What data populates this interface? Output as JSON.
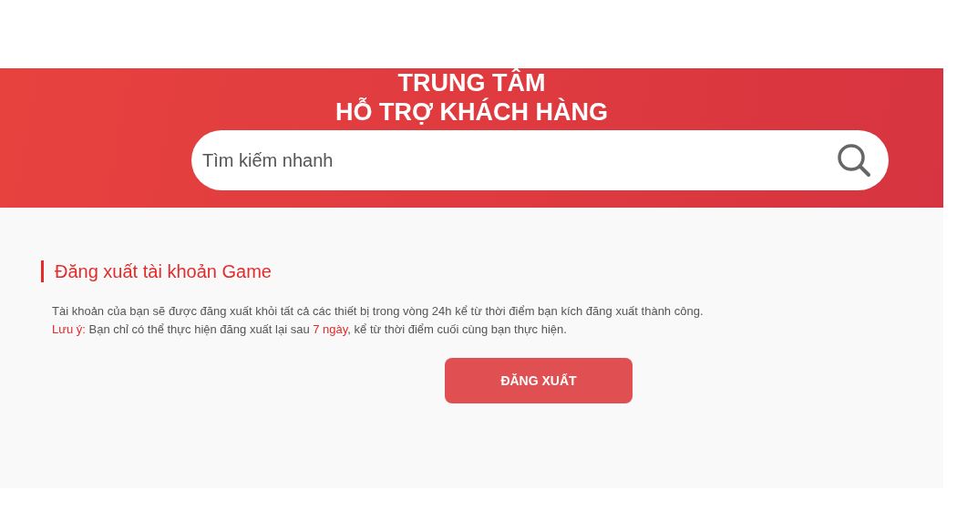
{
  "banner": {
    "title_lines": [
      "TRUNG TÂM",
      "HỖ TRỢ KHÁCH HÀNG"
    ],
    "search": {
      "placeholder": "Tìm kiếm nhanh"
    }
  },
  "section": {
    "heading": "Đăng xuất tài khoản Game",
    "paragraphs": [
      [
        {
          "text": "Tài khoản của bạn sẽ được đăng xuất khỏi tất cả các thiết bị trong vòng 24h kể từ thời điểm bạn kích đăng xuất thành công.",
          "highlight": false
        }
      ],
      [
        {
          "text": "Lưu ý:",
          "highlight": true
        },
        {
          "text": " Bạn chỉ có thể thực hiện đăng xuất lại sau ",
          "highlight": false
        },
        {
          "text": "7 ngày",
          "highlight": true
        },
        {
          "text": ", kể từ thời điểm cuối cùng bạn thực hiện.",
          "highlight": false
        }
      ]
    ],
    "button": "ĐĂNG XUẤT"
  }
}
